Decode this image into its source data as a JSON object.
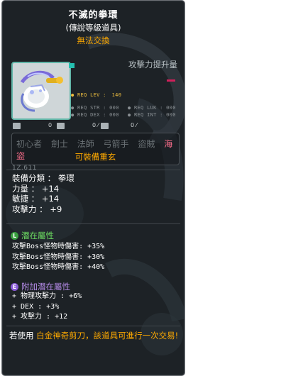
{
  "item": {
    "name": "不滅的拳環",
    "grade": "(傳說等級道具)",
    "trade": "無法交換"
  },
  "attack_label": "攻擊力提升量",
  "requirements": {
    "lev": {
      "label": "● REQ LEV :",
      "value": "140"
    },
    "str": "● REQ STR : 000",
    "dex": "● REQ DEX : 000",
    "luk": "● REQ LUK : 000",
    "int": "● REQ INT : 000"
  },
  "icon_row": {
    "a": "0",
    "b": "0 ⁄",
    "c": "0 ⁄"
  },
  "classes": {
    "list": [
      "初心者",
      "劍士",
      "法師",
      "弓箭手",
      "盜賊",
      "海盜"
    ],
    "equippable": "可裝備重玄"
  },
  "stats": {
    "category": "裝備分類 ： 拳環",
    "str": "力量 ： +14",
    "dex": "敏捷 ： +14",
    "atk": "攻擊力 ： +9"
  },
  "potential": {
    "title": "潛在屬性",
    "lines": [
      "攻擊Boss怪物時傷害: +35%",
      "攻擊Boss怪物時傷害: +30%",
      "攻擊Boss怪物時傷害: +40%"
    ]
  },
  "bonus_potential": {
    "title": "附加潛在屬性",
    "lines": [
      "+ 物理攻擊力 : +6%",
      "+ DEX : +3%",
      "+ 攻擊力 : +12"
    ]
  },
  "footer": {
    "prefix": "若使用 ",
    "highlight": "白金神奇剪刀",
    "suffix": "，該道具可進行一次交易!"
  },
  "badges": {
    "potential": "L",
    "bonus": "E"
  },
  "background_text": "1Z.611",
  "colors": {
    "tooltip_bg": "#1d2226",
    "gold": "#ffaa00",
    "potential_green": "#6ee062",
    "bonus_purple": "#b58be8",
    "pirate_pink": "#ff6f8d"
  }
}
